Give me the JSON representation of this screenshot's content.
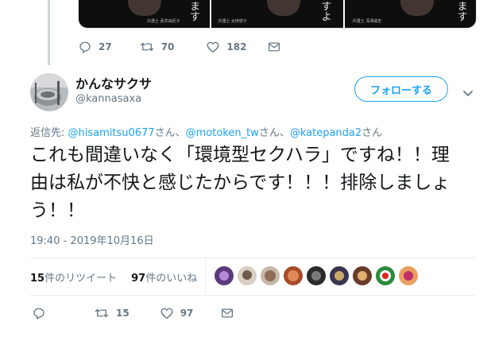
{
  "prev_tweet": {
    "media_texts": [
      "ます",
      "すよ",
      "ます"
    ],
    "media_captions": [
      "弁護士 武井由紀子",
      "弁護士 太田啓子",
      "弁護士 深澤諭史"
    ],
    "replies": "27",
    "retweets": "70",
    "likes": "182"
  },
  "tweet": {
    "display_name": "かんなサクサ",
    "handle": "@kannasaxa",
    "follow_label": "フォローする",
    "reply_prefix": "返信先: ",
    "mentions": [
      "@hisamitsu0677",
      "@motoken_tw",
      "@katepanda2"
    ],
    "mention_suffix": "さん",
    "mention_sep": "、",
    "text": "これも間違いなく「環境型セクハラ」ですね！！理由は私が不快と感じたからです！！！排除しましょう！！",
    "timestamp": "19:40 - 2019年10月16日",
    "retweet_count": "15",
    "retweet_label": "件のリツイート",
    "like_count": "97",
    "like_label": "件のいいね",
    "action_retweets": "15",
    "action_likes": "97"
  },
  "colors": {
    "accent": "#1da1f2",
    "secondary_text": "#657786",
    "text": "#14171a"
  },
  "icons": [
    "reply-icon",
    "retweet-icon",
    "like-icon",
    "message-icon",
    "chevron-down-icon"
  ]
}
